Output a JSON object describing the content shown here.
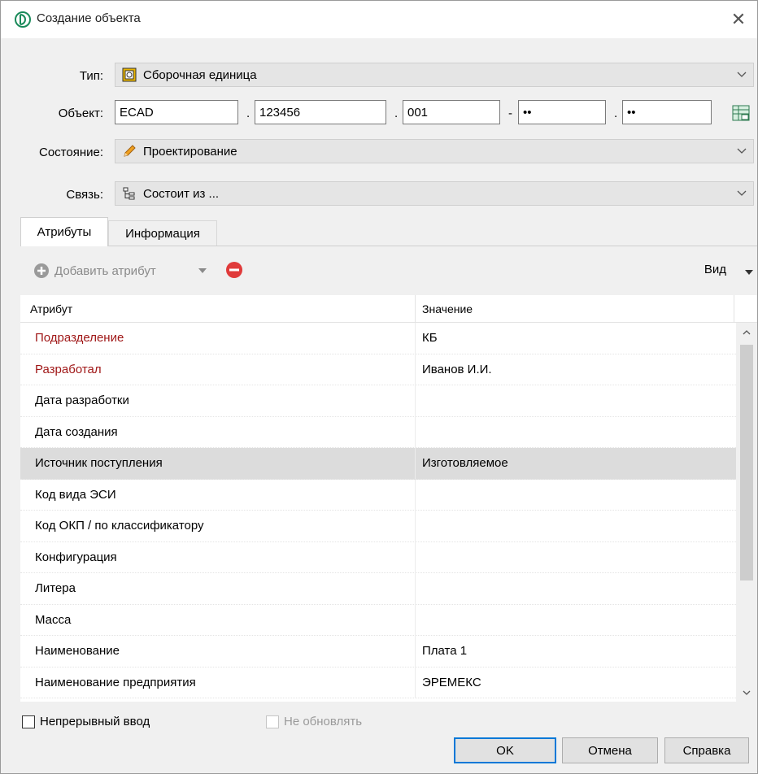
{
  "window": {
    "title": "Создание объекта",
    "close_glyph": "✕"
  },
  "form": {
    "type_label": "Тип:",
    "type_value": "Сборочная единица",
    "object_label": "Объект:",
    "object_fields": [
      "ECAD",
      "123456",
      "001",
      "••",
      "••"
    ],
    "object_separators": [
      ".",
      ".",
      "-",
      "."
    ],
    "state_label": "Состояние:",
    "state_value": "Проектирование",
    "link_label": "Связь:",
    "link_value": "Состоит из ..."
  },
  "tabs": [
    {
      "label": "Атрибуты",
      "active": true
    },
    {
      "label": "Информация",
      "active": false
    }
  ],
  "toolbar": {
    "add_label": "Добавить атрибут",
    "view_label": "Вид"
  },
  "grid": {
    "columns": [
      "Атрибут",
      "Значение"
    ],
    "rows": [
      {
        "name": "Подразделение",
        "value": "КБ",
        "required": true
      },
      {
        "name": "Разработал",
        "value": "Иванов И.И.",
        "required": true
      },
      {
        "name": "Дата разработки",
        "value": ""
      },
      {
        "name": "Дата создания",
        "value": ""
      },
      {
        "name": "Источник поступления",
        "value": "Изготовляемое",
        "selected": true
      },
      {
        "name": "Код вида ЭСИ",
        "value": ""
      },
      {
        "name": "Код ОКП / по классификатору",
        "value": ""
      },
      {
        "name": "Конфигурация",
        "value": ""
      },
      {
        "name": "Литера",
        "value": ""
      },
      {
        "name": "Масса",
        "value": ""
      },
      {
        "name": "Наименование",
        "value": "Плата 1"
      },
      {
        "name": "Наименование предприятия",
        "value": "ЭРЕМЕКС"
      }
    ]
  },
  "footer": {
    "continuous_input_label": "Непрерывный ввод",
    "no_update_label": "Не обновлять",
    "ok_label": "OK",
    "cancel_label": "Отмена",
    "help_label": "Справка"
  },
  "colors": {
    "required_text": "#a01818",
    "selected_row": "#dcdcdc",
    "default_button_border": "#0078d7"
  }
}
